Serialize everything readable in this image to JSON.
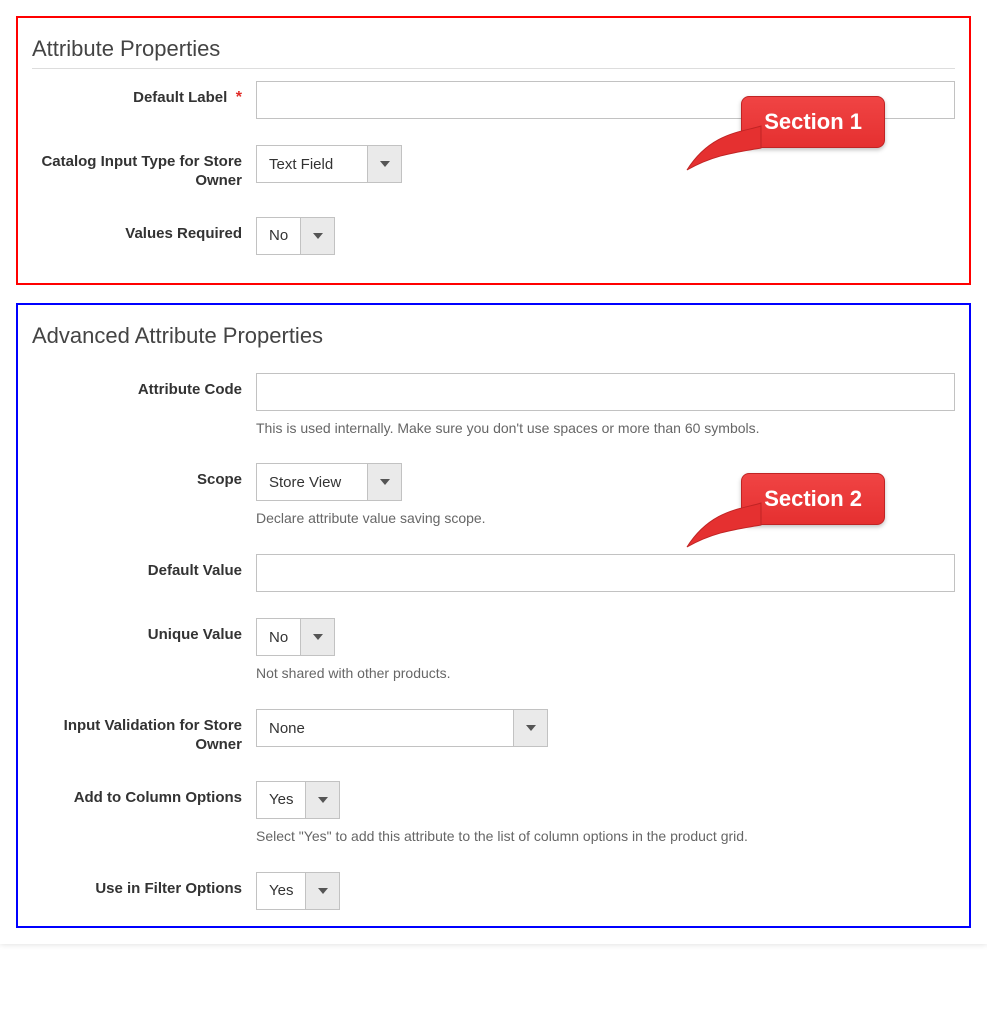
{
  "callouts": {
    "section1": "Section 1",
    "section2": "Section 2"
  },
  "section1": {
    "title": "Attribute Properties",
    "default_label": {
      "label": "Default Label",
      "value": "",
      "required_mark": "*"
    },
    "input_type": {
      "label": "Catalog Input Type for Store Owner",
      "value": "Text Field"
    },
    "values_required": {
      "label": "Values Required",
      "value": "No"
    }
  },
  "section2": {
    "title": "Advanced Attribute Properties",
    "attribute_code": {
      "label": "Attribute Code",
      "value": "",
      "hint": "This is used internally. Make sure you don't use spaces or more than 60 symbols."
    },
    "scope": {
      "label": "Scope",
      "value": "Store View",
      "hint": "Declare attribute value saving scope."
    },
    "default_value": {
      "label": "Default Value",
      "value": ""
    },
    "unique_value": {
      "label": "Unique Value",
      "value": "No",
      "hint": "Not shared with other products."
    },
    "input_validation": {
      "label": "Input Validation for Store Owner",
      "value": "None"
    },
    "add_to_columns": {
      "label": "Add to Column Options",
      "value": "Yes",
      "hint": "Select \"Yes\" to add this attribute to the list of column options in the product grid."
    },
    "use_in_filter": {
      "label": "Use in Filter Options",
      "value": "Yes"
    }
  }
}
